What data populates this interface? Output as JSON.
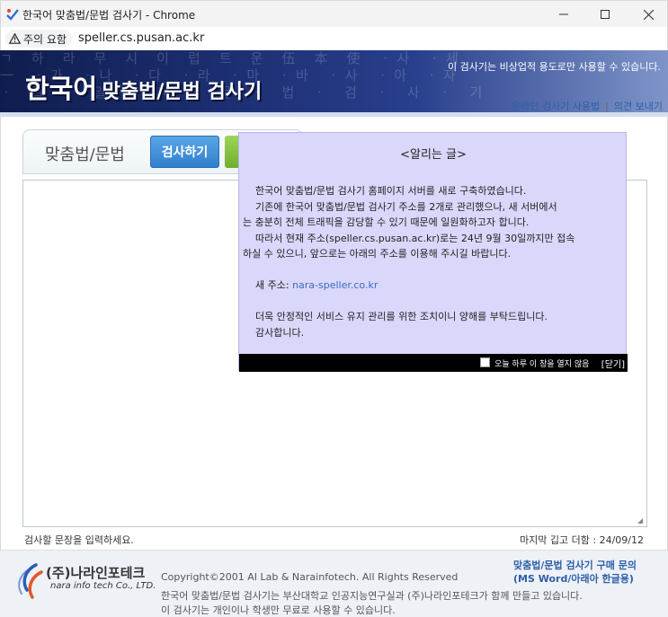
{
  "window": {
    "title": "한국어 맞춤법/문법 검사기 - Chrome",
    "minimize_glyph": "—",
    "maximize_glyph": "☐",
    "close_glyph": "✕"
  },
  "address_bar": {
    "security_label": "주의 요함",
    "url": "speller.cs.pusan.ac.kr"
  },
  "header": {
    "title_main": "한국어",
    "title_sub": "맞춤법/문법 검사기",
    "notice": "이 검사기는 비상업적 용도로만 사용할 수 있습니다.",
    "links": [
      "온라인 검사기 사용법",
      "의견 보내기"
    ],
    "link_separator": "|",
    "bg_colors": [
      "#0f1d4e",
      "#283f8c",
      "#7f95c9"
    ]
  },
  "tabs": {
    "label": "맞춤법/문법",
    "check_button": "검사하기"
  },
  "editor": {
    "hint_left": "검사할 문장을 입력하세요.",
    "hint_right": "마지막 깁고 더함 : 24/09/12"
  },
  "popup": {
    "title": "<알리는 글>",
    "lines": [
      "한국어 맞춤법/문법 검사기 홈페이지 서버를 새로 구축하였습니다.",
      "기존에 한국어 맞춤법/문법 검사기 주소를 2개로 관리했으나, 새 서버에서",
      "는 충분히 전체 트래픽을 감당할 수 있기 때문에 일원화하고자 합니다.",
      "따라서 현재 주소(speller.cs.pusan.ac.kr)로는 24년 9월 30일까지만 접속",
      "하실 수 있으니, 앞으로는 아래의 주소를 이용해 주시길 바랍니다."
    ],
    "new_address_label": "새 주소: ",
    "new_address": "nara-speller.co.kr",
    "closing_line1": "더욱 안정적인 서비스 유지 관리를 위한 조치이니 양해를 부탁드립니다.",
    "closing_line2": "감사합니다.",
    "dont_show_label": "오늘 하루 이 창을 열지 않음",
    "close_label": "[닫기]",
    "bg_color": "#d9d8fb",
    "link_color": "#3a6cc4"
  },
  "footer": {
    "company_ko": "(주)나라인포테크",
    "company_en": "nara info tech Co., LTD.",
    "copyright": "Copyright©2001 AI Lab & Narainfotech. All Rights Reserved",
    "line1": "한국어 맞춤법/문법 검사기는 부산대학교 인공지능연구실과 (주)나라인포테크가 함께 만들고 있습니다.",
    "line2": "이 검사기는 개인이나 학생만 무료로 사용할 수 있습니다.",
    "buy_line1": "맞춤법/문법 검사기 구매 문의",
    "buy_line2": "(MS Word/아래아 한글용)"
  }
}
